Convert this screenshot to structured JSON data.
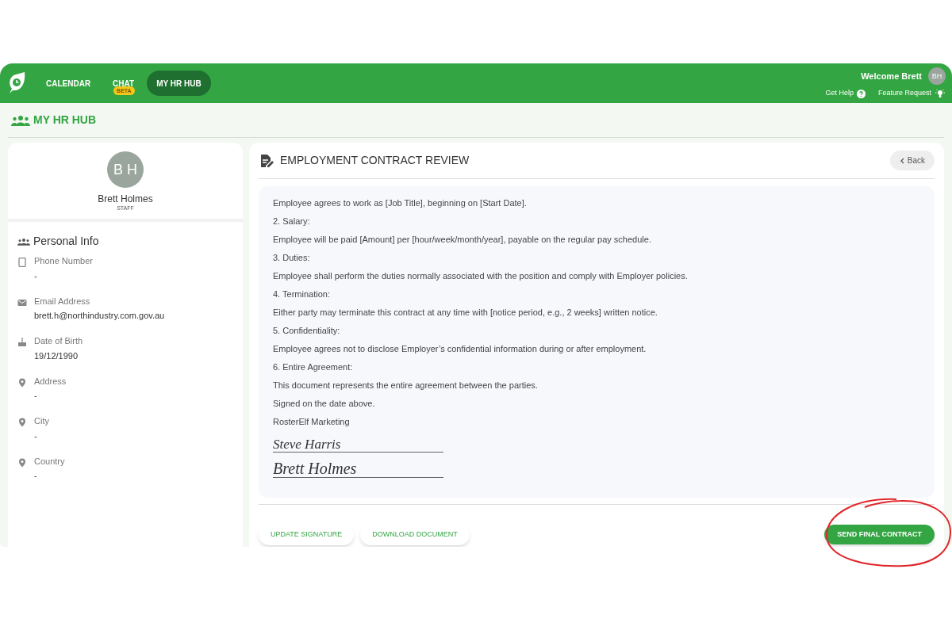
{
  "nav": {
    "items": [
      {
        "label": "CALENDAR",
        "selected": false
      },
      {
        "label": "CHAT",
        "selected": false,
        "badge": "BETA"
      },
      {
        "label": "MY HR HUB",
        "selected": true
      }
    ],
    "welcome": "Welcome Brett",
    "avatar": "BH",
    "help": "Get Help",
    "feature": "Feature Request"
  },
  "page_title": "MY HR HUB",
  "profile": {
    "initials": "B H",
    "name": "Brett Holmes",
    "role": "STAFF",
    "section_title": "Personal Info",
    "fields": [
      {
        "kind": "phone",
        "label": "Phone Number",
        "value": "-"
      },
      {
        "kind": "email",
        "label": "Email Address",
        "value": "brett.h@northindustry.com.gov.au"
      },
      {
        "kind": "birthday",
        "label": "Date of Birth",
        "value": "19/12/1990"
      },
      {
        "kind": "location",
        "label": "Address",
        "value": "-"
      },
      {
        "kind": "location",
        "label": "City",
        "value": "-"
      },
      {
        "kind": "location",
        "label": "Country",
        "value": "-"
      }
    ]
  },
  "contract": {
    "title": "EMPLOYMENT CONTRACT REVIEW",
    "back": "Back",
    "lines": [
      "Employee agrees to work as [Job Title], beginning on [Start Date].",
      "2. Salary:",
      "Employee will be paid [Amount] per [hour/week/month/year], payable on the regular pay schedule.",
      "3. Duties:",
      "Employee shall perform the duties normally associated with the position and comply with Employer policies.",
      "4. Termination:",
      "Either party may terminate this contract at any time with [notice period, e.g., 2 weeks] written notice.",
      "5. Confidentiality:",
      "Employee agrees not to disclose Employer’s confidential information during or after employment.",
      "6. Entire Agreement:",
      "This document represents the entire agreement between the parties.",
      "Signed on the date above.",
      "RosterElf Marketing"
    ],
    "signatures": [
      "Steve Harris",
      "Brett Holmes"
    ],
    "buttons": [
      "UPDATE SIGNATURE",
      "DOWNLOAD DOCUMENT"
    ],
    "primary_button": "SEND FINAL CONTRACT"
  }
}
